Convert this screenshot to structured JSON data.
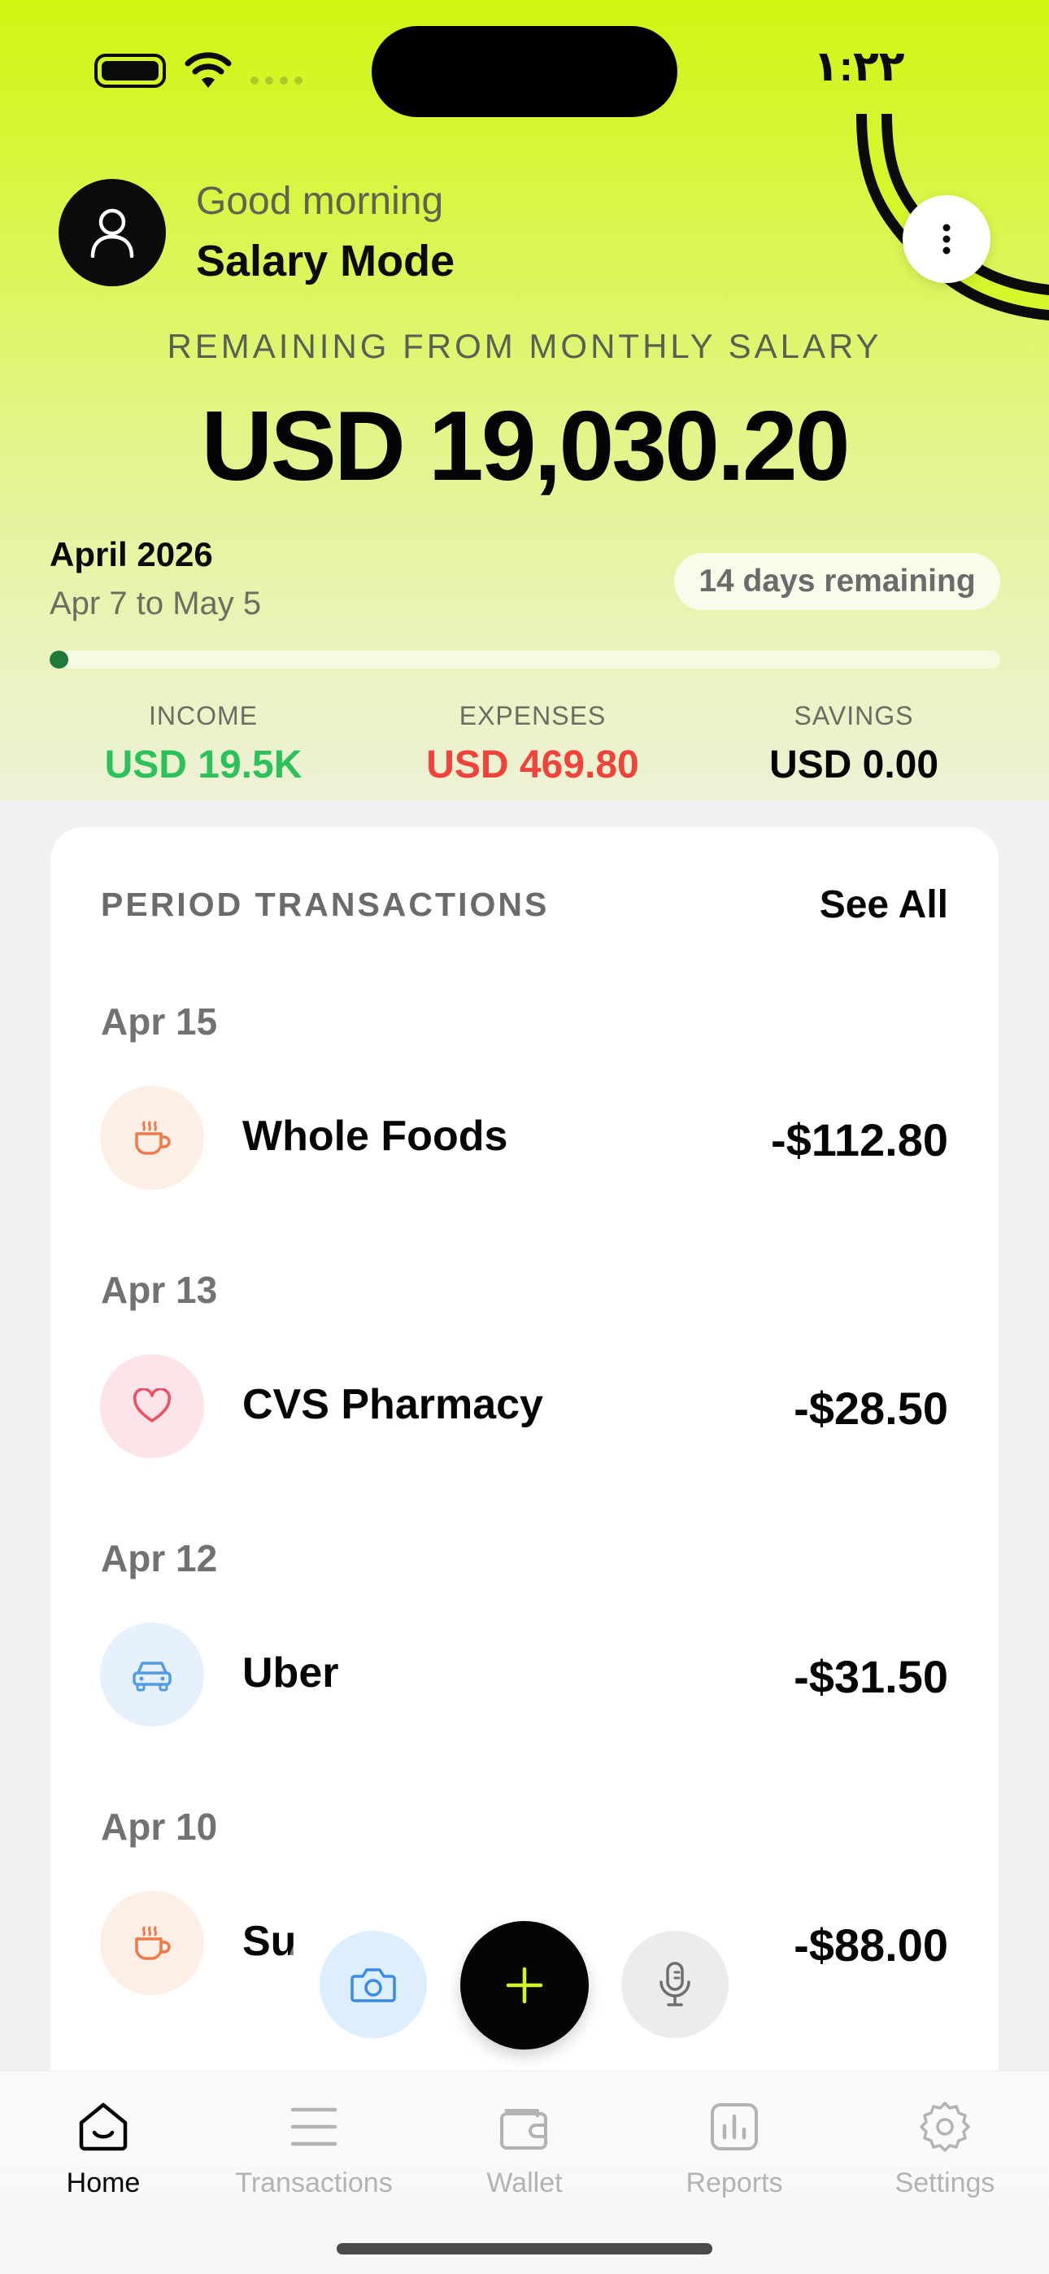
{
  "status_bar": {
    "time": "١:٢٢"
  },
  "header": {
    "greeting": "Good morning",
    "mode_name": "Salary Mode",
    "remaining_label": "REMAINING FROM MONTHLY SALARY",
    "balance": "USD 19,030.20",
    "period_month": "April 2026",
    "period_range": "Apr 7 to May 5",
    "days_remaining": "14 days remaining",
    "period_progress": 0.02,
    "progress_color": "#1f7a3a",
    "accent_color": "#d0f611"
  },
  "stats": {
    "income_label": "INCOME",
    "income_value": "USD 19.5K",
    "expenses_label": "EXPENSES",
    "expenses_value": "USD 469.80",
    "savings_label": "SAVINGS",
    "savings_value": "USD 0.00"
  },
  "transactions": {
    "title": "PERIOD TRANSACTIONS",
    "see_all": "See All",
    "groups": [
      {
        "date": "Apr 15",
        "name": "Whole Foods",
        "amount": "-$112.80",
        "icon": "coffee-cup-icon"
      },
      {
        "date": "Apr 13",
        "name": "CVS Pharmacy",
        "amount": "-$28.50",
        "icon": "heart-icon"
      },
      {
        "date": "Apr 12",
        "name": "Uber",
        "amount": "-$31.50",
        "icon": "car-icon"
      },
      {
        "date": "Apr 10",
        "name": "Su",
        "amount": "-$88.00",
        "icon": "coffee-cup-icon"
      }
    ]
  },
  "actions": {
    "camera_icon": "camera-icon",
    "add_icon": "plus-icon",
    "mic_icon": "microphone-icon"
  },
  "tabbar": {
    "tabs": [
      {
        "label": "Home",
        "icon": "home-icon",
        "active": true
      },
      {
        "label": "Transactions",
        "icon": "list-icon",
        "active": false
      },
      {
        "label": "Wallet",
        "icon": "wallet-icon",
        "active": false
      },
      {
        "label": "Reports",
        "icon": "bar-chart-icon",
        "active": false
      },
      {
        "label": "Settings",
        "icon": "gear-icon",
        "active": false
      }
    ]
  }
}
